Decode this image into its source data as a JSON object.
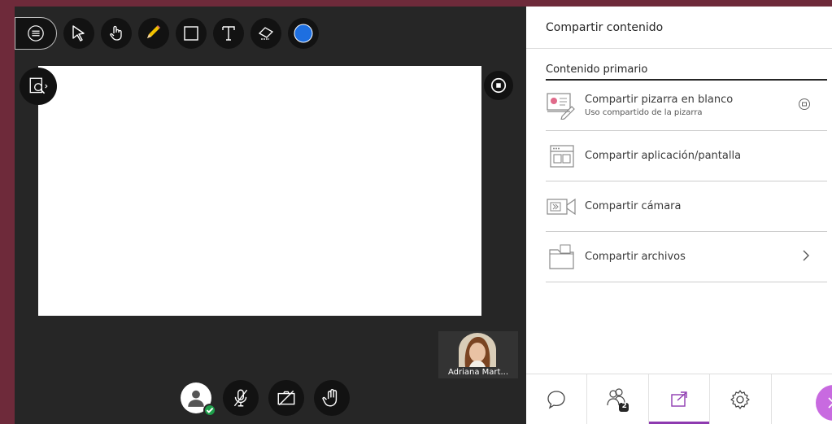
{
  "toolbar": {
    "tools": [
      "menu-icon",
      "select-arrow-icon",
      "pan-hand-icon",
      "pencil-icon",
      "rectangle-icon",
      "text-icon",
      "eraser-icon",
      "color-swatch-icon"
    ],
    "active_color": "#1e6fe0"
  },
  "participant": {
    "name": "Adriana Mart..."
  },
  "bottom_controls": [
    "avatar",
    "microphone-muted-icon",
    "camera-off-icon",
    "raise-hand-icon"
  ],
  "panel": {
    "title": "Compartir contenido",
    "section": "Contenido primario",
    "items": [
      {
        "label": "Compartir pizarra en blanco",
        "sub": "Uso compartido de la pizarra",
        "icon": "whiteboard-icon"
      },
      {
        "label": "Compartir aplicación/pantalla",
        "icon": "screen-share-icon"
      },
      {
        "label": "Compartir cámara",
        "icon": "camera-share-icon"
      },
      {
        "label": "Compartir archivos",
        "icon": "folder-icon"
      }
    ],
    "footer_tabs": [
      "chat-icon",
      "attendees-icon",
      "share-content-icon",
      "settings-icon"
    ],
    "attendee_count": "2",
    "accent": "#8e3ab0"
  }
}
